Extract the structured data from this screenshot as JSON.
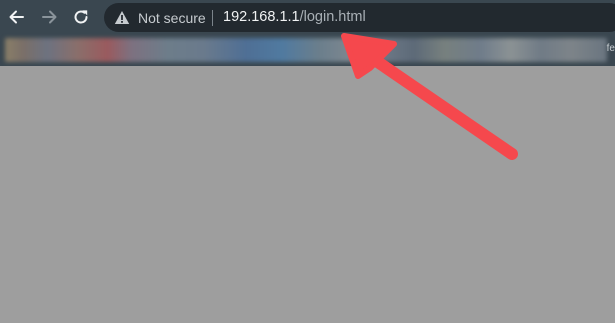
{
  "toolbar": {
    "back_icon": "arrow-left-icon",
    "forward_icon": "arrow-right-icon",
    "reload_icon": "reload-icon"
  },
  "omnibox": {
    "security_icon": "warning-triangle-icon",
    "security_label": "Not secure",
    "url_host": "192.168.1.1",
    "url_path": "/login.html"
  },
  "bookmarks": {
    "overflow_text": "fe"
  },
  "annotation": {
    "arrow_color": "#f5484d"
  },
  "colors": {
    "toolbar_bg": "#3a4750",
    "omnibox_bg": "#22292f",
    "page_bg": "#9e9e9e"
  }
}
